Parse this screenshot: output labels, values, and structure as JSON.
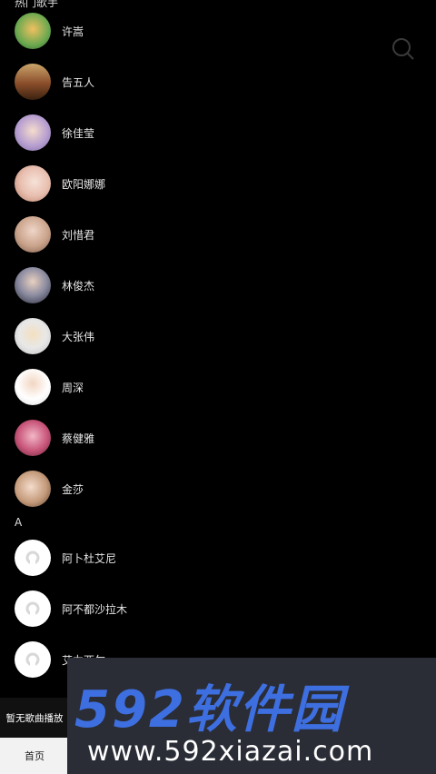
{
  "sections": {
    "hot_label": "热门歌手",
    "a_label": "A"
  },
  "hot_artists": [
    {
      "name": "许嵩"
    },
    {
      "name": "告五人"
    },
    {
      "name": "徐佳莹"
    },
    {
      "name": "欧阳娜娜"
    },
    {
      "name": "刘惜君"
    },
    {
      "name": "林俊杰"
    },
    {
      "name": "大张伟"
    },
    {
      "name": "周深"
    },
    {
      "name": "蔡健雅"
    },
    {
      "name": "金莎"
    }
  ],
  "a_artists": [
    {
      "name": "阿卜杜艾尼"
    },
    {
      "name": "阿不都沙拉木"
    },
    {
      "name": "艾力西尔"
    }
  ],
  "player": {
    "status": "暂无歌曲播放"
  },
  "tabbar": {
    "home_label": "首页"
  },
  "watermark": {
    "brand": "592软件园",
    "url": "www.592xiazai.com"
  },
  "icons": {
    "search": "search-icon",
    "default_avatar": "default-avatar-icon"
  },
  "colors": {
    "background": "#000000",
    "watermark_blue": "#3e6fe0"
  }
}
